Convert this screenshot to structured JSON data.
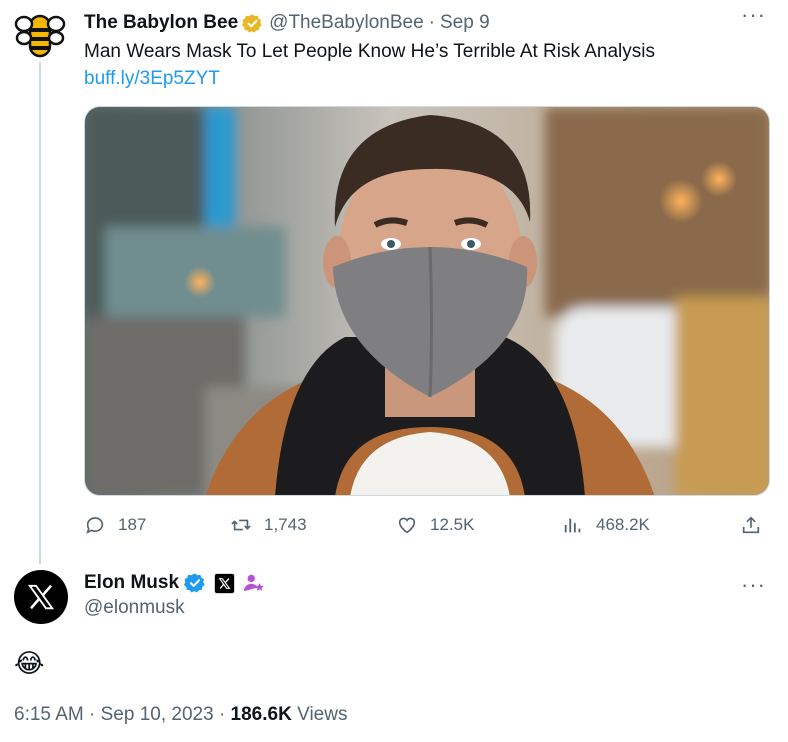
{
  "quoted_tweet": {
    "display_name": "The Babylon Bee",
    "handle": "@TheBabylonBee",
    "separator": "·",
    "date": "Sep 9",
    "text": "Man Wears Mask To Let People Know He’s Terrible At Risk Analysis",
    "link": "buff.ly/3Ep5ZYT",
    "more_icon": "more-horizontal-icon",
    "verified_badge": {
      "icon": "gold-check-badge-icon",
      "color": "#e8b829"
    },
    "actions": {
      "replies": "187",
      "reposts": "1,743",
      "likes": "12.5K",
      "views": "468.2K"
    }
  },
  "main_tweet": {
    "display_name": "Elon Musk",
    "handle": "@elonmusk",
    "badges": [
      {
        "icon": "blue-check-badge-icon",
        "color": "#1d9bf0"
      },
      {
        "icon": "x-affiliate-badge-icon",
        "color": "#000000"
      },
      {
        "icon": "person-star-icon",
        "color": "#b84fd8"
      }
    ],
    "body_emoji": "😂",
    "time": "6:15 AM",
    "sep1": "·",
    "date": "Sep 10, 2023",
    "sep2": "·",
    "views_count": "186.6K",
    "views_label": "Views"
  },
  "colors": {
    "link": "#1d9bf0",
    "secondary_text": "#536471",
    "thread_line": "#cfd9de"
  }
}
